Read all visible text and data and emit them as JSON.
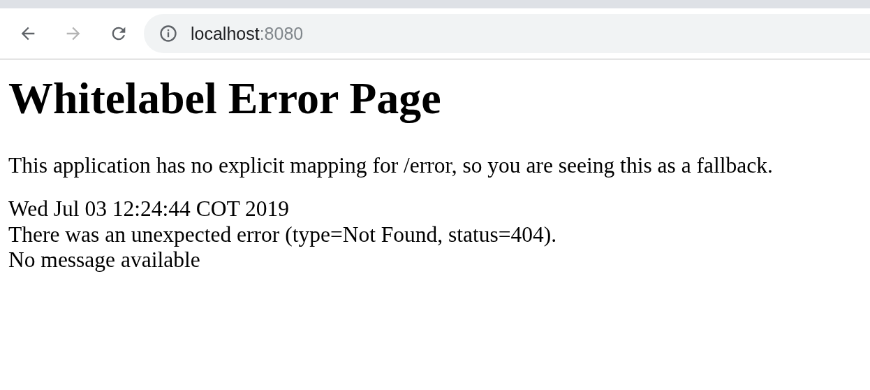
{
  "toolbar": {
    "nav_buttons": [
      {
        "kind": "back",
        "disabled": false
      },
      {
        "kind": "forward",
        "disabled": true
      },
      {
        "kind": "reload",
        "disabled": false
      }
    ],
    "address": {
      "host": "localhost",
      "port": ":8080"
    }
  },
  "page": {
    "heading": "Whitelabel Error Page",
    "paragraph": "This application has no explicit mapping for /error, so you are seeing this as a fallback.",
    "lines": [
      "Wed Jul 03 12:24:44 COT 2019",
      "There was an unexpected error (type=Not Found, status=404).",
      "No message available"
    ]
  }
}
